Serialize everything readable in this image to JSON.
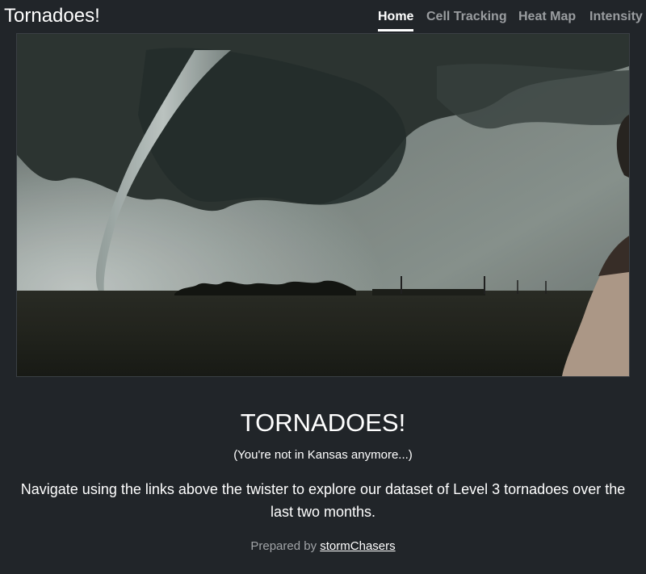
{
  "navbar": {
    "brand": "Tornadoes!",
    "links": [
      {
        "label": "Home",
        "active": true
      },
      {
        "label": "Cell Tracking",
        "active": false
      },
      {
        "label": "Heat Map",
        "active": false
      },
      {
        "label": "Intensity",
        "active": false
      }
    ]
  },
  "hero": {
    "image_subject": "tornado funnel over plains photo"
  },
  "main": {
    "title": "TORNADOES!",
    "subtitle": "(You're not in Kansas anymore...)",
    "description": "Navigate using the links above the twister to explore our dataset of Level 3 tornadoes over the last two months.",
    "credit_prefix": "Prepared by",
    "credit_link": "stormChasers"
  },
  "colors": {
    "background": "#212529",
    "text": "#ffffff",
    "muted_text": "#9a9da0"
  }
}
